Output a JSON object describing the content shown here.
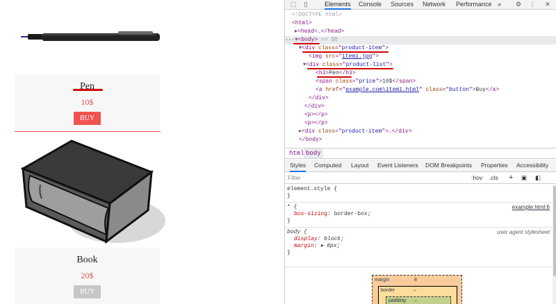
{
  "page": {
    "products": [
      {
        "name": "Pen",
        "price": "10$",
        "button": "BUY",
        "image_icon": "pen-image",
        "button_color": "#ef5350"
      },
      {
        "name": "Book",
        "price": "20$",
        "button": "BUY",
        "image_icon": "book-image",
        "button_color": "#c7c7c7"
      }
    ],
    "accent_color": "#e24a4a"
  },
  "devtools": {
    "tabs": [
      "Elements",
      "Console",
      "Sources",
      "Network",
      "Performance"
    ],
    "more_tabs": "»",
    "active_tab": "Elements",
    "tree": {
      "doctype": "<!DOCTYPE html>",
      "html_open": "<html>",
      "head": "<head>…</head>",
      "body_open": "<body>",
      "body_marker": "== $0",
      "dots": "···",
      "div_item": {
        "tag": "div",
        "attr": "class",
        "val": "product-item"
      },
      "img": {
        "tag": "img",
        "attr": "src",
        "val": "item1.jpg"
      },
      "div_list": {
        "tag": "div",
        "attr": "class",
        "val": "product-list"
      },
      "h3": {
        "tag": "h3",
        "text": "Pen"
      },
      "span": {
        "tag": "span",
        "attr": "class",
        "val": "price",
        "text": "10$"
      },
      "a": {
        "tag": "a",
        "attr1": "href",
        "val1": "example.com\\item1.html",
        "attr2": "class",
        "val2": "button",
        "text": "Buy"
      },
      "div_close": "</div>",
      "div_close2": "</div>",
      "p1": "<p></p>",
      "p2": "<p></p>",
      "div_item2": {
        "tag": "div",
        "attr": "class",
        "val": "product-item",
        "rest": "…</div>"
      },
      "body_close": "</body>"
    },
    "breadcrumbs": [
      "html",
      "body"
    ],
    "subtabs": [
      "Styles",
      "Computed",
      "Layout",
      "Event Listeners",
      "DOM Breakpoints",
      "Properties",
      "Accessibility"
    ],
    "active_subtab": "Styles",
    "filter": {
      "placeholder": "Filter",
      "hov": ":hov",
      "cls": ".cls",
      "plus": "+"
    },
    "rules": {
      "element_style": {
        "selector": "element.style {",
        "close": "}"
      },
      "star": {
        "selector": "* {",
        "source": "example.html:6",
        "prop": "box-sizing",
        "value": "border-box;",
        "close": "}"
      },
      "body": {
        "selector": "body {",
        "source": "user agent stylesheet",
        "prop1": "display",
        "value1": "block;",
        "prop2": "margin",
        "value2": "▸ 8px;",
        "close": "}"
      }
    },
    "boxmodel": {
      "margin_label": "margin",
      "margin_value": "8",
      "border_label": "border",
      "border_value": "–",
      "padding_label": "padding",
      "padding_value": "–"
    }
  }
}
